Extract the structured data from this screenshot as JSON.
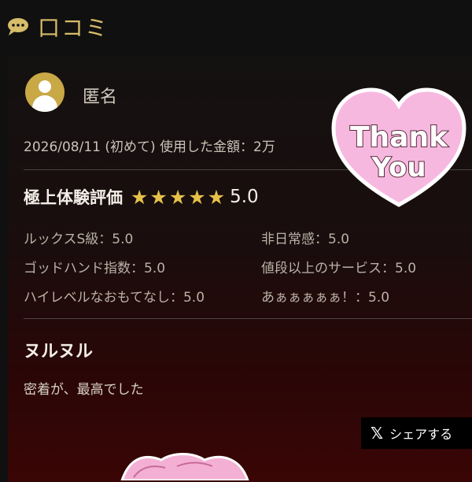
{
  "section": {
    "title": "口コミ",
    "icon": "speech-bubble-icon"
  },
  "review": {
    "username": "匿名",
    "meta": "2026/08/11 (初めて) 使用した金額：2万",
    "rating_label": "極上体験評価",
    "rating_value": "5.0",
    "stars": 5,
    "sub_ratings": [
      "ルックスS級：5.0",
      "非日常感：5.0",
      "ゴッドハンド指数：5.0",
      "値段以上のサービス：5.0",
      "ハイレベルなおもてなし：5.0",
      "あぁぁぁぁぁ！：5.0"
    ],
    "title": "ヌルヌル",
    "body": "密着が、最高でした"
  },
  "sticker": {
    "line1": "Thank",
    "line2": "You"
  },
  "share": {
    "label": "シェアする",
    "icon": "x-logo-icon"
  },
  "colors": {
    "accent_gold": "#d6bd6a",
    "star": "#e6c14a",
    "sticker_pink": "#f7b8e0",
    "background": "#111010"
  }
}
